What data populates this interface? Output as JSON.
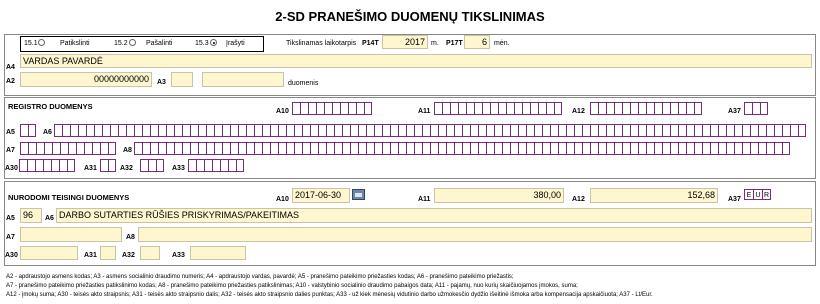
{
  "title": "2-SD PRANEŠIMO DUOMENŲ TIKSLINIMAS",
  "options": {
    "o1": {
      "code": "15.1",
      "label": "Patikslinti",
      "selected": false
    },
    "o2": {
      "code": "15.2",
      "label": "Pašalinti",
      "selected": false
    },
    "o3": {
      "code": "15.3",
      "label": "Įrašyti",
      "selected": true
    }
  },
  "period": {
    "label": "Tikslinamas laikotarpis",
    "p14t": "P14T",
    "year": "2017",
    "year_unit": "m.",
    "p17t": "P17T",
    "month": "6",
    "month_unit": "mėn."
  },
  "top": {
    "a4_label": "A4",
    "a4_value": "VARDAS PAVARDĖ",
    "a2_label": "A2",
    "a2_value": "00000000000",
    "a3_label": "A3",
    "a3_value": "",
    "duomenis": "duomenis"
  },
  "registro": {
    "heading": "REGISTRO DUOMENYS",
    "a10": "A10",
    "a11": "A11",
    "a12": "A12",
    "a37": "A37",
    "a5": "A5",
    "a6": "A6",
    "a7": "A7",
    "a8": "A8",
    "a30": "A30",
    "a31": "A31",
    "a32": "A32",
    "a33": "A33"
  },
  "teisingi": {
    "heading": "NURODOMI TEISINGI DUOMENYS",
    "a10": "A10",
    "a10_value": "2017-06-30",
    "a11": "A11",
    "a11_value": "380,00",
    "a12": "A12",
    "a12_value": "152,68",
    "a37": "A37",
    "currency": [
      "E",
      "U",
      "R"
    ],
    "a5": "A5",
    "a5_value": "96",
    "a6": "A6",
    "a6_value": "DARBO SUTARTIES RŪŠIES PRISKYRIMAS/PAKEITIMAS",
    "a7": "A7",
    "a8": "A8",
    "a30": "A30",
    "a31": "A31",
    "a32": "A32",
    "a33": "A33"
  },
  "footnotes": [
    "A2 - apdraustojo asmens kodas; A3 - asmens socialinio draudimo numeris; A4 - apdraustojo vardas, pavardė; A5 - pranešimo pateikimo priežasties kodas; A6 - pranešimo pateikimo priežastis;",
    "A7 - pranešimo pateikimo priežasties patikslinimo kodas; A8 - pranešimo pateikimo priežasties patikslinimas; A10 - valstybinio socialinio draudimo pabaigos data; A11 - pajamų, nuo kurių skaičiuojamos įmokos, suma;",
    "A12 - įmokų suma; A30 - teisės akto straipsnis; A31 - teisės akto straipsnio dalis; A32 - teisės akto straipsnio dalies punktas; A33 - už kiek mėnesių vidutinio darbo užmokesčio dydžio išeitinė išmoka arba kompensacija apskaičiuota; A37 - Lt/Eur."
  ]
}
